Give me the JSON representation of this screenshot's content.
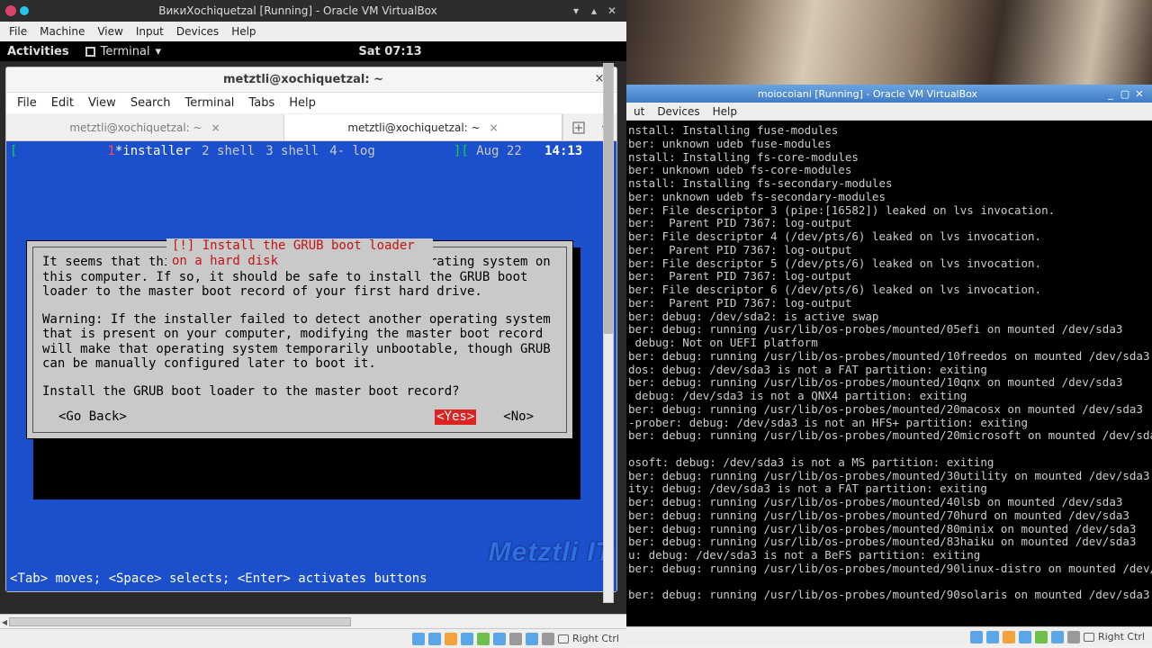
{
  "left_vm": {
    "title": "ВикиXochiquetzal [Running] - Oracle VM VirtualBox",
    "menubar": [
      "File",
      "Machine",
      "View",
      "Input",
      "Devices",
      "Help"
    ],
    "status_hostkey": "Right Ctrl"
  },
  "gnome": {
    "activities": "Activities",
    "app": "Terminal",
    "clock": "Sat 07:13"
  },
  "terminal": {
    "title": "metztli@xochiquetzal: ~",
    "menubar": [
      "File",
      "Edit",
      "View",
      "Search",
      "Terminal",
      "Tabs",
      "Help"
    ],
    "tabs": [
      "metztli@xochiquetzal: ~",
      "metztli@xochiquetzal: ~"
    ],
    "active_tab": 1
  },
  "tui": {
    "status_left_bracket": "[",
    "pane_active_num": "1",
    "pane_active_label": "*installer",
    "panes_inactive": [
      "2 shell",
      "3 shell",
      "4- log"
    ],
    "status_right_bracket": "][",
    "date": "Aug 22",
    "time": "14:13",
    "status_close": "]",
    "dialog_title": "[!] Install the GRUB boot loader on a hard disk",
    "body1": "It seems that this new installation is the only operating system on this computer. If so, it should be safe to install the GRUB boot loader to the master boot record of your first hard drive.",
    "body2": "Warning: If the installer failed to detect another operating system that is present on your computer, modifying the master boot record will make that operating system temporarily unbootable, though GRUB can be manually configured later to boot it.",
    "question": "Install the GRUB boot loader to the master boot record?",
    "go_back": "<Go Back>",
    "yes": "<Yes>",
    "no": "<No>",
    "helpline": "<Tab> moves; <Space> selects; <Enter> activates buttons",
    "watermark": "Metztli IT"
  },
  "right_vm": {
    "title": "moiocoiani [Running] - Oracle VM VirtualBox",
    "menubar": [
      "ut",
      "Devices",
      "Help"
    ],
    "status_hostkey": "Right Ctrl",
    "log": "nstall: Installing fuse-modules\nber: unknown udeb fuse-modules\nnstall: Installing fs-core-modules\nber: unknown udeb fs-core-modules\nnstall: Installing fs-secondary-modules\nber: unknown udeb fs-secondary-modules\nber: File descriptor 3 (pipe:[16582]) leaked on lvs invocation.\nber:  Parent PID 7367: log-output\nber: File descriptor 4 (/dev/pts/6) leaked on lvs invocation.\nber:  Parent PID 7367: log-output\nber: File descriptor 5 (/dev/pts/6) leaked on lvs invocation.\nber:  Parent PID 7367: log-output\nber: File descriptor 6 (/dev/pts/6) leaked on lvs invocation.\nber:  Parent PID 7367: log-output\nber: debug: /dev/sda2: is active swap\nber: debug: running /usr/lib/os-probes/mounted/05efi on mounted /dev/sda3\n debug: Not on UEFI platform\nber: debug: running /usr/lib/os-probes/mounted/10freedos on mounted /dev/sda3\ndos: debug: /dev/sda3 is not a FAT partition: exiting\nber: debug: running /usr/lib/os-probes/mounted/10qnx on mounted /dev/sda3\n debug: /dev/sda3 is not a QNX4 partition: exiting\nber: debug: running /usr/lib/os-probes/mounted/20macosx on mounted /dev/sda3\n-prober: debug: /dev/sda3 is not an HFS+ partition: exiting\nber: debug: running /usr/lib/os-probes/mounted/20microsoft on mounted /dev/sda\n\nosoft: debug: /dev/sda3 is not a MS partition: exiting\nber: debug: running /usr/lib/os-probes/mounted/30utility on mounted /dev/sda3\nity: debug: /dev/sda3 is not a FAT partition: exiting\nber: debug: running /usr/lib/os-probes/mounted/40lsb on mounted /dev/sda3\nber: debug: running /usr/lib/os-probes/mounted/70hurd on mounted /dev/sda3\nber: debug: running /usr/lib/os-probes/mounted/80minix on mounted /dev/sda3\nber: debug: running /usr/lib/os-probes/mounted/83haiku on mounted /dev/sda3\nu: debug: /dev/sda3 is not a BeFS partition: exiting\nber: debug: running /usr/lib/os-probes/mounted/90linux-distro on mounted /dev/\n\nber: debug: running /usr/lib/os-probes/mounted/90solaris on mounted /dev/sda3"
  }
}
